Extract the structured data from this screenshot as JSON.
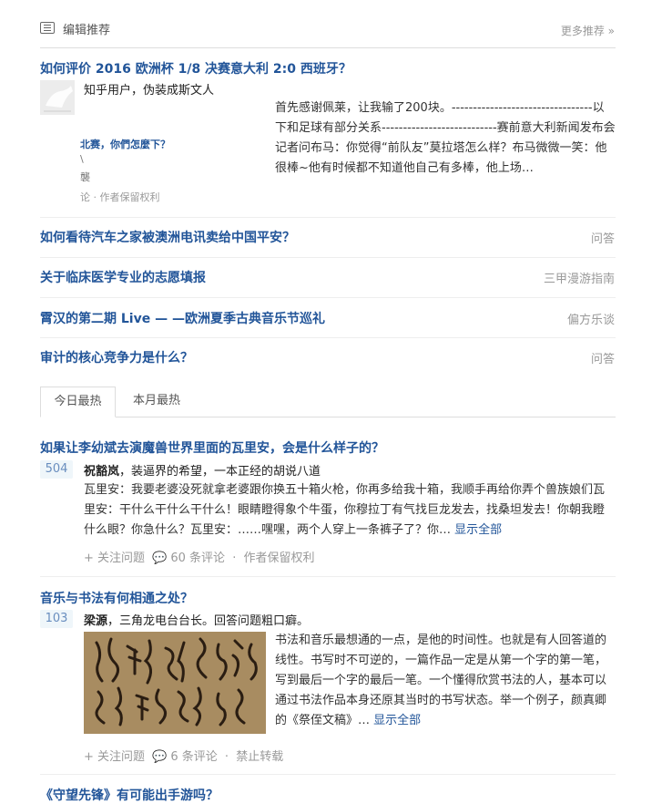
{
  "header": {
    "title": "编辑推荐",
    "more": "更多推荐 »"
  },
  "featured": {
    "title": "如何评价 2016 欧洲杯 1/8 决赛意大利 2:0 西班牙？",
    "author": "知乎用户，伪装成斯文人",
    "excerpt": "首先感谢佩莱，让我输了200块。---------------------------------以下和足球有部分关系---------------------------赛前意大利新闻发布会记者问布马：你觉得“前队友”莫拉塔怎么样？布马微微一笑：他很棒~他有时候都不知道他自己有多棒，他上场…",
    "cover_text": {
      "line1": "北赛，你們怎麼下？",
      "line2": "\\",
      "line3": "襲",
      "meta": "论 · 作者保留权利"
    }
  },
  "editor_list": [
    {
      "title": "如何看待汽车之家被澳洲电讯卖给中国平安？",
      "tag": "问答"
    },
    {
      "title": "关于临床医学专业的志愿填报",
      "tag": "三甲漫游指南"
    },
    {
      "title": "霄汉的第二期 Live — —欧洲夏季古典音乐节巡礼",
      "tag": "偏方乐谈"
    },
    {
      "title": "审计的核心竞争力是什么？",
      "tag": "问答"
    }
  ],
  "tabs": {
    "active": "今日最热",
    "other": "本月最热"
  },
  "hot": [
    {
      "title": "如果让李幼斌去演魔兽世界里面的瓦里安，会是什么样子的？",
      "votes": "504",
      "author_name": "祝豁岚",
      "author_bio": "，装逼界的希望，一本正经的胡说八道",
      "excerpt": "瓦里安：我要老婆没死就拿老婆跟你换五十箱火枪，你再多给我十箱，我顺手再给你弄个兽族娘们瓦里安：干什么干什么干什么！眼睛瞪得象个牛蛋，你穆拉丁有气找巨龙发去，找桑坦发去！你朝我瞪什么眼？你急什么？瓦里安：……嘿嘿，两个人穿上一条裤子了？你…",
      "show_all": "显示全部",
      "follow": "+ 关注问题",
      "comments": "60 条评论",
      "rights": "作者保留权利"
    },
    {
      "title": "音乐与书法有何相通之处？",
      "votes": "103",
      "author_name": "梁源",
      "author_bio": "，三角龙电台台长。回答问题粗口癖。",
      "excerpt": "书法和音乐最想通的一点，是他的时间性。也就是有人回答道的线性。书写时不可逆的，一篇作品一定是从第一个字的第一笔，写到最后一个字的最后一笔。一个懂得欣赏书法的人，基本可以通过书法作品本身还原其当时的书写状态。举一个例子，颜真卿的《祭侄文稿》…",
      "show_all": "显示全部",
      "follow": "+ 关注问题",
      "comments": "6 条评论",
      "rights": "禁止转载"
    },
    {
      "title": "《守望先锋》有可能出手游吗？"
    }
  ],
  "colors": {
    "link": "#225599",
    "meta": "#999999",
    "vote_bg": "#eff6fa",
    "vote_text": "#698ebf"
  }
}
